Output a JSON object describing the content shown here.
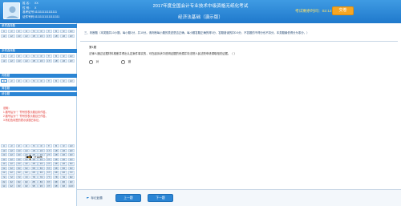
{
  "header": {
    "title": "2017年度全国会计专业技术中级资格无纸化考试",
    "subtitle": "经济法基础（演示版）",
    "time_label": "考试剩余时间：02:12:03",
    "submit_label": "交卷",
    "candidate": {
      "name_label": "姓 名：",
      "name_value": "XX",
      "gender_label": "性 别：",
      "gender_value": "X",
      "exam_no_label": "准考证号：",
      "exam_no_value": "1111111111111111",
      "id_label": "证件号码：",
      "id_value": "111111111111111111"
    }
  },
  "sidebar": {
    "sections": [
      {
        "title": "单项选择题",
        "count": 20
      },
      {
        "title": "多项选择题",
        "count": 20
      },
      {
        "title": "判断题",
        "count": 10
      },
      {
        "title": "简答题",
        "count": 0
      },
      {
        "title": "综合题",
        "count": 0
      }
    ],
    "legend": [
      "说明：",
      "1.题号后为“！”符号的表示题目未作答。",
      "2.题号后为“？”符号的表示题目已作答。",
      "3.有红色标签的表示该题已标记。"
    ],
    "calculator_label": "计算器"
  },
  "main": {
    "instructions": "三、判断题（本类题共10小题，每小题1分，共10分。请判断每小题的表述是否正确。每小题答题正确的得1分，答题错误的扣0.5分，不答题的不得分也不扣分。本类题最低得分为零分。）",
    "question_number": "第1题",
    "question_text": "法律人通过证据材料推断并得出认定案件事实的，可在起诉状中说明证据的来源并向法院人民法院申请调取相关证据。（ ）",
    "options": [
      {
        "label": "对"
      },
      {
        "label": "错"
      }
    ]
  },
  "footer": {
    "mark_label": "标记此题",
    "prev_label": "上一题",
    "next_label": "下一题"
  },
  "colors": {
    "header": "#1f79cc",
    "accent": "#2b85d4",
    "submit": "#f6a623",
    "legend_text": "#e0302b"
  }
}
